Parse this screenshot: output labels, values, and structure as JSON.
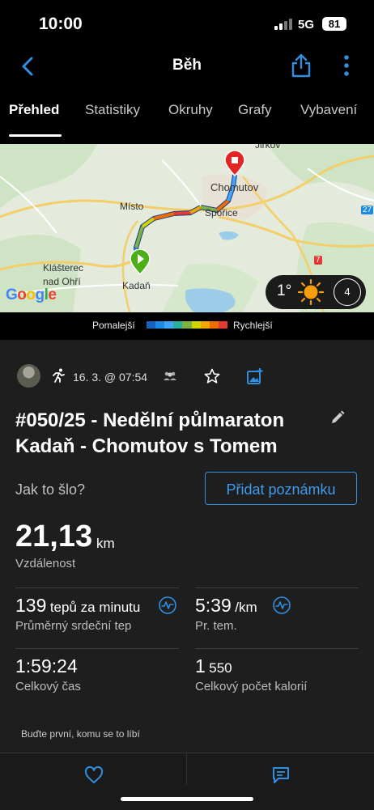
{
  "status_bar": {
    "time": "10:00",
    "network": "5G",
    "battery": "81"
  },
  "nav": {
    "title": "Běh",
    "back_icon": "chevron-left-icon",
    "share_icon": "share-icon",
    "more_icon": "more-vertical-icon"
  },
  "tabs": [
    {
      "label": "Přehled",
      "active": true
    },
    {
      "label": "Statistiky",
      "active": false
    },
    {
      "label": "Okruhy",
      "active": false
    },
    {
      "label": "Grafy",
      "active": false
    },
    {
      "label": "Vybavení",
      "active": false
    }
  ],
  "map": {
    "places": [
      "Jirkov",
      "Chomutov",
      "Místo",
      "Spořice",
      "Klášterec",
      "nad Ohří",
      "Kadaň"
    ],
    "road_number": "27",
    "road_number_2": "7",
    "logo": "Google",
    "weather": {
      "temperature": "1°",
      "wind": "4"
    }
  },
  "legend": {
    "slower": "Pomalejší",
    "faster": "Rychlejší",
    "colors": [
      "#1565c0",
      "#1e88e5",
      "#42a5f5",
      "#2bb0a0",
      "#7cb342",
      "#d4d400",
      "#f0a800",
      "#ef6c00",
      "#e53935"
    ]
  },
  "activity": {
    "date": "16. 3. @ 07:54",
    "title": "#050/25 - Nedělní půlmaraton Kadaň - Chomutov s Tomem",
    "how_prompt": "Jak to šlo?",
    "add_note": "Přidat poznámku",
    "distance": {
      "value": "21,13",
      "unit": "km",
      "label": "Vzdálenost"
    },
    "heart_rate": {
      "value": "139",
      "unit": "tepů za minutu",
      "label": "Průměrný srdeční tep"
    },
    "pace": {
      "value": "5:39",
      "unit": "/km",
      "label": "Pr. tem."
    },
    "time": {
      "value": "1:59:24",
      "label": "Celkový čas"
    },
    "calories": {
      "value_big": "1",
      "value_small": "550",
      "label": "Celkový počet kalorií"
    },
    "likes_prompt": "Buďte první, komu se to líbí"
  },
  "colors": {
    "accent": "#2f8fe0",
    "background": "#000000",
    "panel": "#1e1e1e"
  }
}
